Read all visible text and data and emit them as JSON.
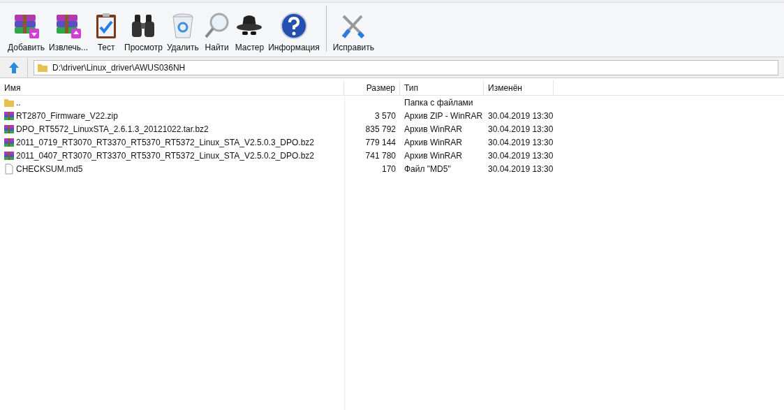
{
  "toolbar": [
    {
      "label": "Добавить",
      "kind": "add"
    },
    {
      "label": "Извлечь...",
      "kind": "extract"
    },
    {
      "label": "Тест",
      "kind": "test"
    },
    {
      "label": "Просмотр",
      "kind": "view"
    },
    {
      "label": "Удалить",
      "kind": "delete"
    },
    {
      "label": "Найти",
      "kind": "find"
    },
    {
      "label": "Мастер",
      "kind": "wizard"
    },
    {
      "label": "Информация",
      "kind": "info"
    },
    {
      "label": "Исправить",
      "kind": "repair"
    }
  ],
  "address": {
    "path": "D:\\driver\\Linux_driver\\AWUS036NH"
  },
  "table": {
    "columns": [
      "Имя",
      "Размер",
      "Тип",
      "Изменён"
    ],
    "rows": [
      {
        "kind": "folder",
        "name": "..",
        "type": "Папка с файлами"
      },
      {
        "kind": "archive",
        "name": "RT2870_Firmware_V22.zip",
        "size": "3 570",
        "type": "Архив ZIP - WinRAR",
        "modified": "30.04.2019 13:30"
      },
      {
        "kind": "archive",
        "name": "DPO_RT5572_LinuxSTA_2.6.1.3_20121022.tar.bz2",
        "size": "835 792",
        "type": "Архив WinRAR",
        "modified": "30.04.2019 13:30"
      },
      {
        "kind": "archive",
        "name": "2011_0719_RT3070_RT3370_RT5370_RT5372_Linux_STA_V2.5.0.3_DPO.bz2",
        "size": "779 144",
        "type": "Архив WinRAR",
        "modified": "30.04.2019 13:30"
      },
      {
        "kind": "archive",
        "name": "2011_0407_RT3070_RT3370_RT5370_RT5372_Linux_STA_V2.5.0.2_DPO.bz2",
        "size": "741 780",
        "type": "Архив WinRAR",
        "modified": "30.04.2019 13:30"
      },
      {
        "kind": "file",
        "name": "CHECKSUM.md5",
        "size": "170",
        "type": "Файл \"MD5\"",
        "modified": "30.04.2019 13:30"
      }
    ]
  }
}
